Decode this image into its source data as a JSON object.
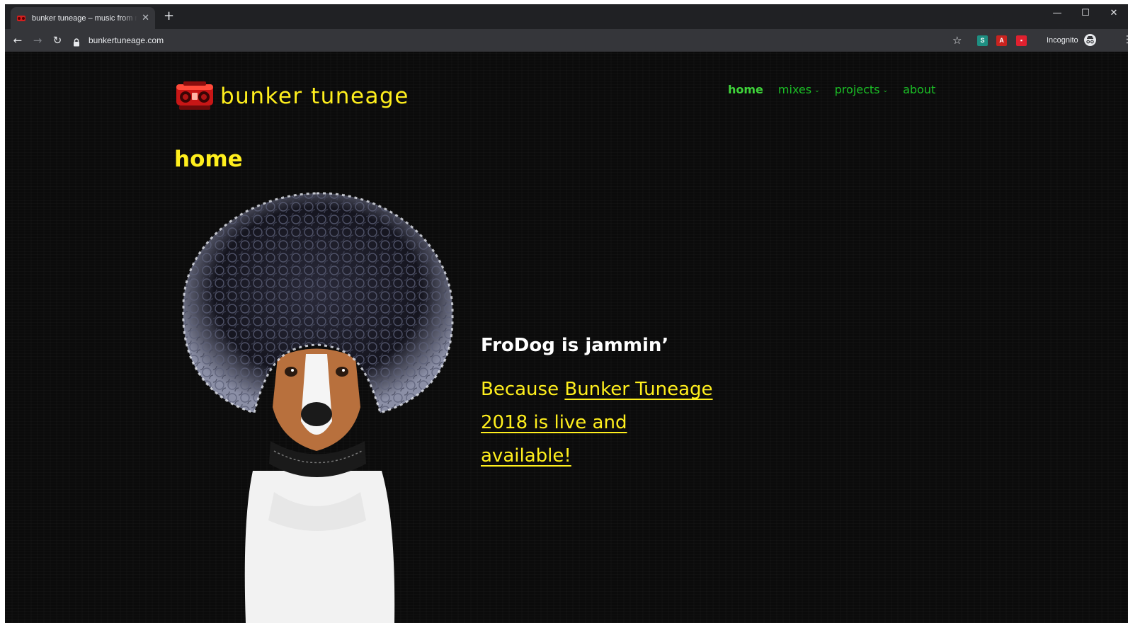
{
  "browser": {
    "tab_title": "bunker tuneage – music from my",
    "tab_close": "✕",
    "new_tab": "+",
    "url": "bunkertuneage.com",
    "back": "←",
    "forward": "→",
    "reload": "↻",
    "star": "☆",
    "incognito_label": "Incognito",
    "window_controls": {
      "minimize": "—",
      "maximize": "☐",
      "close": "✕"
    },
    "menu": "⋮"
  },
  "site": {
    "logo_text": "bunker tuneage",
    "nav": [
      {
        "label": "home",
        "active": true
      },
      {
        "label": "mixes",
        "dropdown": true
      },
      {
        "label": "projects",
        "dropdown": true
      },
      {
        "label": "about"
      }
    ],
    "caret": "⌄",
    "page_title": "home",
    "headline": "FroDog is jammin’",
    "body_prefix": "Because ",
    "body_link": "Bunker Tuneage 2018 is live and available!"
  },
  "colors": {
    "accent_yellow": "#ffef1d",
    "nav_green": "#1bbf26",
    "background": "#0b0b0b"
  },
  "icons": [
    "lock-icon",
    "star-icon",
    "extension-icon",
    "pdf-icon",
    "incognito-icon",
    "boombox-logo-icon"
  ]
}
